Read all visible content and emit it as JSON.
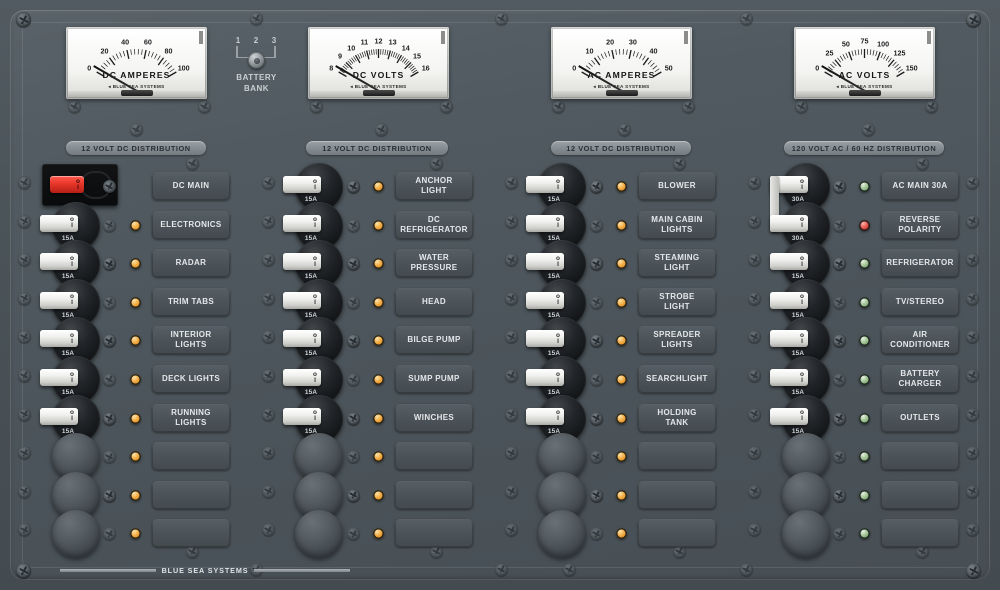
{
  "panel": {
    "brand": "BLUE SEA SYSTEMS",
    "accent_amber": "#f2a83c",
    "accent_green": "#9cc08f",
    "accent_red": "#e3534a",
    "panel_color": "#4b545a"
  },
  "meters": [
    {
      "name": "dc-amperes",
      "title": "DC AMPERES",
      "brand": "BLUE SEA SYSTEMS",
      "ticks": [
        "0",
        "20",
        "40",
        "60",
        "80",
        "100"
      ],
      "min": 0,
      "max": 100,
      "value": 0,
      "unit": "A"
    },
    {
      "name": "dc-volts",
      "title": "DC VOLTS",
      "brand": "BLUE SEA SYSTEMS",
      "ticks": [
        "8",
        "9",
        "10",
        "11",
        "12",
        "13",
        "14",
        "15",
        "16"
      ],
      "min": 8,
      "max": 16,
      "value": 8,
      "unit": "V"
    },
    {
      "name": "ac-amperes",
      "title": "AC AMPERES",
      "brand": "BLUE SEA SYSTEMS",
      "ticks": [
        "0",
        "10",
        "20",
        "30",
        "40",
        "50"
      ],
      "min": 0,
      "max": 50,
      "value": 0,
      "unit": "A"
    },
    {
      "name": "ac-volts",
      "title": "AC VOLTS",
      "brand": "BLUE SEA SYSTEMS",
      "ticks": [
        "0",
        "25",
        "50",
        "75",
        "100",
        "125",
        "150"
      ],
      "min": 0,
      "max": 150,
      "value": 0,
      "unit": "V"
    }
  ],
  "battery_bank": {
    "label_line1": "BATTERY",
    "label_line2": "BANK",
    "positions": [
      "1",
      "2",
      "3"
    ],
    "selected": "2"
  },
  "sections": [
    {
      "name": "section-1",
      "title": "12 VOLT DC DISTRIBUTION"
    },
    {
      "name": "section-2",
      "title": "12 VOLT DC DISTRIBUTION"
    },
    {
      "name": "section-3",
      "title": "12 VOLT DC DISTRIBUTION"
    },
    {
      "name": "section-4",
      "title": "120 VOLT AC / 60 HZ DISTRIBUTION"
    }
  ],
  "toggle_marks": {
    "on": "o",
    "off": "I"
  },
  "columns": [
    {
      "id": "col-1",
      "rows": [
        {
          "label": "DC MAIN",
          "rating": "",
          "led": "none",
          "toggle": "red",
          "kind": "main"
        },
        {
          "label": "ELECTRONICS",
          "rating": "15A",
          "led": "amber",
          "toggle": "white",
          "kind": "breaker"
        },
        {
          "label": "RADAR",
          "rating": "15A",
          "led": "amber",
          "toggle": "white",
          "kind": "breaker"
        },
        {
          "label": "TRIM TABS",
          "rating": "15A",
          "led": "amber",
          "toggle": "white",
          "kind": "breaker"
        },
        {
          "label": "INTERIOR LIGHTS",
          "rating": "15A",
          "led": "amber",
          "toggle": "white",
          "kind": "breaker"
        },
        {
          "label": "DECK LIGHTS",
          "rating": "15A",
          "led": "amber",
          "toggle": "white",
          "kind": "breaker"
        },
        {
          "label": "RUNNING LIGHTS",
          "rating": "15A",
          "led": "amber",
          "toggle": "white",
          "kind": "breaker"
        },
        {
          "label": "",
          "rating": "",
          "led": "amber",
          "toggle": "none",
          "kind": "blank"
        },
        {
          "label": "",
          "rating": "",
          "led": "amber",
          "toggle": "none",
          "kind": "blank"
        },
        {
          "label": "",
          "rating": "",
          "led": "amber",
          "toggle": "none",
          "kind": "blank"
        }
      ]
    },
    {
      "id": "col-2",
      "rows": [
        {
          "label": "ANCHOR LIGHT",
          "rating": "15A",
          "led": "amber",
          "toggle": "white",
          "kind": "breaker"
        },
        {
          "label": "DC REFRIGERATOR",
          "rating": "15A",
          "led": "amber",
          "toggle": "white",
          "kind": "breaker"
        },
        {
          "label": "WATER PRESSURE",
          "rating": "15A",
          "led": "amber",
          "toggle": "white",
          "kind": "breaker"
        },
        {
          "label": "HEAD",
          "rating": "15A",
          "led": "amber",
          "toggle": "white",
          "kind": "breaker"
        },
        {
          "label": "BILGE PUMP",
          "rating": "15A",
          "led": "amber",
          "toggle": "white",
          "kind": "breaker"
        },
        {
          "label": "SUMP PUMP",
          "rating": "15A",
          "led": "amber",
          "toggle": "white",
          "kind": "breaker"
        },
        {
          "label": "WINCHES",
          "rating": "15A",
          "led": "amber",
          "toggle": "white",
          "kind": "breaker"
        },
        {
          "label": "",
          "rating": "",
          "led": "amber",
          "toggle": "none",
          "kind": "blank"
        },
        {
          "label": "",
          "rating": "",
          "led": "amber",
          "toggle": "none",
          "kind": "blank"
        },
        {
          "label": "",
          "rating": "",
          "led": "amber",
          "toggle": "none",
          "kind": "blank"
        }
      ]
    },
    {
      "id": "col-3",
      "rows": [
        {
          "label": "BLOWER",
          "rating": "15A",
          "led": "amber",
          "toggle": "white",
          "kind": "breaker"
        },
        {
          "label": "MAIN CABIN LIGHTS",
          "rating": "15A",
          "led": "amber",
          "toggle": "white",
          "kind": "breaker"
        },
        {
          "label": "STEAMING LIGHT",
          "rating": "15A",
          "led": "amber",
          "toggle": "white",
          "kind": "breaker"
        },
        {
          "label": "STROBE LIGHT",
          "rating": "15A",
          "led": "amber",
          "toggle": "white",
          "kind": "breaker"
        },
        {
          "label": "SPREADER LIGHTS",
          "rating": "15A",
          "led": "amber",
          "toggle": "white",
          "kind": "breaker"
        },
        {
          "label": "SEARCHLIGHT",
          "rating": "15A",
          "led": "amber",
          "toggle": "white",
          "kind": "breaker"
        },
        {
          "label": "HOLDING TANK",
          "rating": "15A",
          "led": "amber",
          "toggle": "white",
          "kind": "breaker"
        },
        {
          "label": "",
          "rating": "",
          "led": "amber",
          "toggle": "none",
          "kind": "blank"
        },
        {
          "label": "",
          "rating": "",
          "led": "amber",
          "toggle": "none",
          "kind": "blank"
        },
        {
          "label": "",
          "rating": "",
          "led": "amber",
          "toggle": "none",
          "kind": "blank"
        }
      ]
    },
    {
      "id": "col-4",
      "rows": [
        {
          "label": "AC MAIN 30A",
          "rating": "30A",
          "led": "green",
          "toggle": "white",
          "kind": "ganged-top"
        },
        {
          "label": "REVERSE POLARITY",
          "rating": "30A",
          "led": "red",
          "toggle": "white",
          "kind": "ganged-bottom"
        },
        {
          "label": "REFRIGERATOR",
          "rating": "15A",
          "led": "green",
          "toggle": "white",
          "kind": "breaker"
        },
        {
          "label": "TV/STEREO",
          "rating": "15A",
          "led": "green",
          "toggle": "white",
          "kind": "breaker"
        },
        {
          "label": "AIR CONDITIONER",
          "rating": "15A",
          "led": "green",
          "toggle": "white",
          "kind": "breaker"
        },
        {
          "label": "BATTERY CHARGER",
          "rating": "15A",
          "led": "green",
          "toggle": "white",
          "kind": "breaker"
        },
        {
          "label": "OUTLETS",
          "rating": "15A",
          "led": "green",
          "toggle": "white",
          "kind": "breaker"
        },
        {
          "label": "",
          "rating": "",
          "led": "green",
          "toggle": "none",
          "kind": "blank"
        },
        {
          "label": "",
          "rating": "",
          "led": "green",
          "toggle": "none",
          "kind": "blank"
        },
        {
          "label": "",
          "rating": "",
          "led": "green",
          "toggle": "none",
          "kind": "blank"
        }
      ]
    }
  ]
}
